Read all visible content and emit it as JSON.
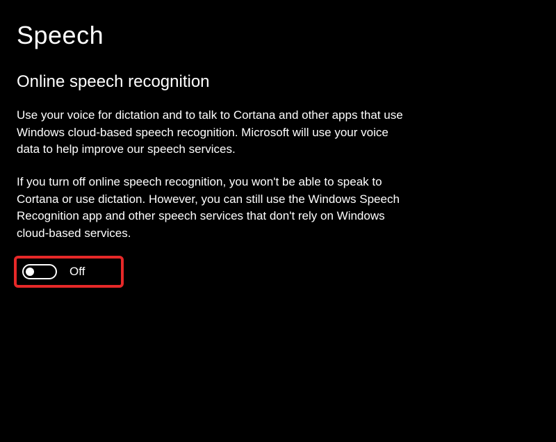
{
  "page": {
    "title": "Speech"
  },
  "section": {
    "heading": "Online speech recognition",
    "description1": "Use your voice for dictation and to talk to Cortana and other apps that use Windows cloud-based speech recognition. Microsoft will use your voice data to help improve our speech services.",
    "description2": "If you turn off online speech recognition, you won't be able to speak to Cortana or use dictation. However, you can still use the Windows Speech Recognition app and other speech services that don't rely on Windows cloud-based services."
  },
  "toggle": {
    "state": "off",
    "label": "Off"
  }
}
